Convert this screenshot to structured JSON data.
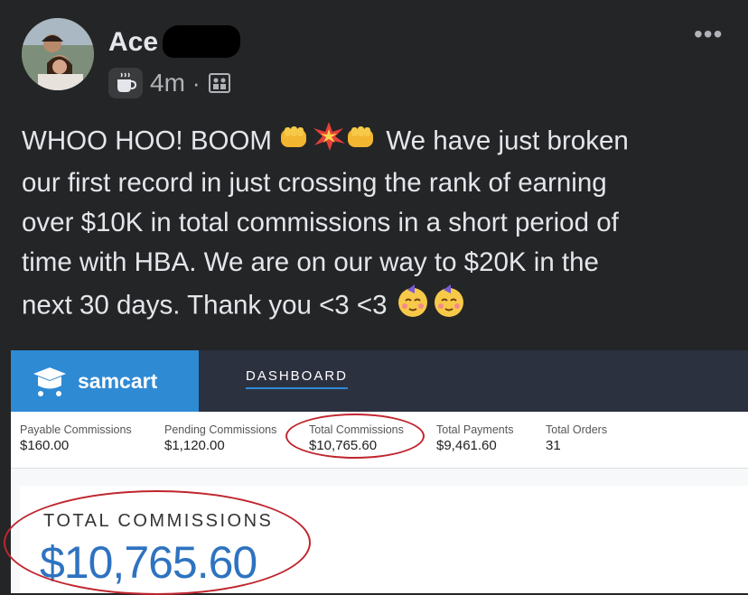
{
  "post": {
    "author": "Ace",
    "time": "4m",
    "separator": "·",
    "more": "•••",
    "text_lines": [
      "WHOO HOO! BOOM",
      "We have just broken",
      "our first record in just crossing the rank of earning",
      "over $10K in total commissions in a short period of",
      "time with HBA. We are on our way to $20K in the",
      "next 30 days. Thank you <3 <3"
    ],
    "icons": [
      "mug-icon",
      "photo-privacy-icon",
      "fist-emoji",
      "collision-emoji",
      "party-face-emoji"
    ]
  },
  "samcart": {
    "brand": "samcart",
    "tab": "DASHBOARD",
    "stats": [
      {
        "label": "Payable Commissions",
        "value": "$160.00"
      },
      {
        "label": "Pending Commissions",
        "value": "$1,120.00"
      },
      {
        "label": "Total Commissions",
        "value": "$10,765.60"
      },
      {
        "label": "Total Payments",
        "value": "$9,461.60"
      },
      {
        "label": "Total Orders",
        "value": "31"
      }
    ],
    "card": {
      "label": "TOTAL COMMISSIONS",
      "value": "$10,765.60"
    },
    "colors": {
      "brand_blue": "#2f8ad4",
      "header_dark": "#2c3140",
      "value_blue": "#2e73c0",
      "annotation_red": "#c0262e"
    }
  }
}
